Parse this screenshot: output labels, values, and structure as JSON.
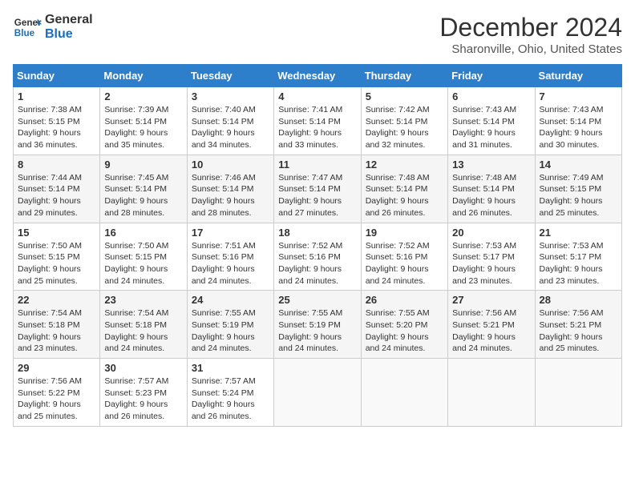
{
  "logo": {
    "line1": "General",
    "line2": "Blue"
  },
  "title": "December 2024",
  "subtitle": "Sharonville, Ohio, United States",
  "days_header": [
    "Sunday",
    "Monday",
    "Tuesday",
    "Wednesday",
    "Thursday",
    "Friday",
    "Saturday"
  ],
  "weeks": [
    [
      {
        "day": "1",
        "sunrise": "7:38 AM",
        "sunset": "5:15 PM",
        "daylight": "9 hours and 36 minutes."
      },
      {
        "day": "2",
        "sunrise": "7:39 AM",
        "sunset": "5:14 PM",
        "daylight": "9 hours and 35 minutes."
      },
      {
        "day": "3",
        "sunrise": "7:40 AM",
        "sunset": "5:14 PM",
        "daylight": "9 hours and 34 minutes."
      },
      {
        "day": "4",
        "sunrise": "7:41 AM",
        "sunset": "5:14 PM",
        "daylight": "9 hours and 33 minutes."
      },
      {
        "day": "5",
        "sunrise": "7:42 AM",
        "sunset": "5:14 PM",
        "daylight": "9 hours and 32 minutes."
      },
      {
        "day": "6",
        "sunrise": "7:43 AM",
        "sunset": "5:14 PM",
        "daylight": "9 hours and 31 minutes."
      },
      {
        "day": "7",
        "sunrise": "7:43 AM",
        "sunset": "5:14 PM",
        "daylight": "9 hours and 30 minutes."
      }
    ],
    [
      {
        "day": "8",
        "sunrise": "7:44 AM",
        "sunset": "5:14 PM",
        "daylight": "9 hours and 29 minutes."
      },
      {
        "day": "9",
        "sunrise": "7:45 AM",
        "sunset": "5:14 PM",
        "daylight": "9 hours and 28 minutes."
      },
      {
        "day": "10",
        "sunrise": "7:46 AM",
        "sunset": "5:14 PM",
        "daylight": "9 hours and 28 minutes."
      },
      {
        "day": "11",
        "sunrise": "7:47 AM",
        "sunset": "5:14 PM",
        "daylight": "9 hours and 27 minutes."
      },
      {
        "day": "12",
        "sunrise": "7:48 AM",
        "sunset": "5:14 PM",
        "daylight": "9 hours and 26 minutes."
      },
      {
        "day": "13",
        "sunrise": "7:48 AM",
        "sunset": "5:14 PM",
        "daylight": "9 hours and 26 minutes."
      },
      {
        "day": "14",
        "sunrise": "7:49 AM",
        "sunset": "5:15 PM",
        "daylight": "9 hours and 25 minutes."
      }
    ],
    [
      {
        "day": "15",
        "sunrise": "7:50 AM",
        "sunset": "5:15 PM",
        "daylight": "9 hours and 25 minutes."
      },
      {
        "day": "16",
        "sunrise": "7:50 AM",
        "sunset": "5:15 PM",
        "daylight": "9 hours and 24 minutes."
      },
      {
        "day": "17",
        "sunrise": "7:51 AM",
        "sunset": "5:16 PM",
        "daylight": "9 hours and 24 minutes."
      },
      {
        "day": "18",
        "sunrise": "7:52 AM",
        "sunset": "5:16 PM",
        "daylight": "9 hours and 24 minutes."
      },
      {
        "day": "19",
        "sunrise": "7:52 AM",
        "sunset": "5:16 PM",
        "daylight": "9 hours and 24 minutes."
      },
      {
        "day": "20",
        "sunrise": "7:53 AM",
        "sunset": "5:17 PM",
        "daylight": "9 hours and 23 minutes."
      },
      {
        "day": "21",
        "sunrise": "7:53 AM",
        "sunset": "5:17 PM",
        "daylight": "9 hours and 23 minutes."
      }
    ],
    [
      {
        "day": "22",
        "sunrise": "7:54 AM",
        "sunset": "5:18 PM",
        "daylight": "9 hours and 23 minutes."
      },
      {
        "day": "23",
        "sunrise": "7:54 AM",
        "sunset": "5:18 PM",
        "daylight": "9 hours and 24 minutes."
      },
      {
        "day": "24",
        "sunrise": "7:55 AM",
        "sunset": "5:19 PM",
        "daylight": "9 hours and 24 minutes."
      },
      {
        "day": "25",
        "sunrise": "7:55 AM",
        "sunset": "5:19 PM",
        "daylight": "9 hours and 24 minutes."
      },
      {
        "day": "26",
        "sunrise": "7:55 AM",
        "sunset": "5:20 PM",
        "daylight": "9 hours and 24 minutes."
      },
      {
        "day": "27",
        "sunrise": "7:56 AM",
        "sunset": "5:21 PM",
        "daylight": "9 hours and 24 minutes."
      },
      {
        "day": "28",
        "sunrise": "7:56 AM",
        "sunset": "5:21 PM",
        "daylight": "9 hours and 25 minutes."
      }
    ],
    [
      {
        "day": "29",
        "sunrise": "7:56 AM",
        "sunset": "5:22 PM",
        "daylight": "9 hours and 25 minutes."
      },
      {
        "day": "30",
        "sunrise": "7:57 AM",
        "sunset": "5:23 PM",
        "daylight": "9 hours and 26 minutes."
      },
      {
        "day": "31",
        "sunrise": "7:57 AM",
        "sunset": "5:24 PM",
        "daylight": "9 hours and 26 minutes."
      },
      null,
      null,
      null,
      null
    ]
  ]
}
